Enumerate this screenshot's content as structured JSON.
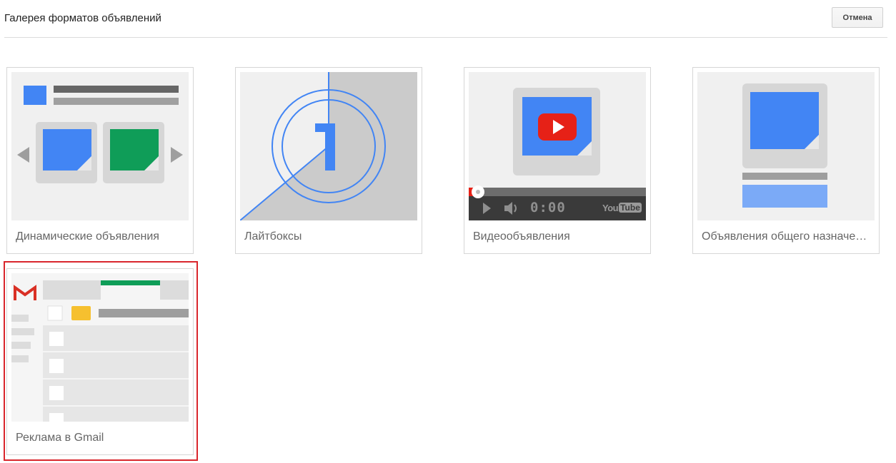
{
  "header": {
    "title": "Галерея форматов объявлений",
    "cancel_label": "Отмена"
  },
  "gallery": {
    "items": [
      {
        "label": "Динамические объявления",
        "icon": "dynamic-ads-illustration"
      },
      {
        "label": "Лайтбоксы",
        "icon": "lightbox-countdown-illustration"
      },
      {
        "label": "Видеообъявления",
        "icon": "video-player-illustration",
        "player_time": "0:00",
        "player_brand": "YouTube"
      },
      {
        "label": "Объявления общего назначения",
        "icon": "general-ad-illustration"
      },
      {
        "label": "Реклама в Gmail",
        "icon": "gmail-inbox-illustration",
        "selected": true
      }
    ]
  },
  "colors": {
    "accent_blue": "#4285f4",
    "accent_green": "#0f9d58",
    "selection_red": "#d9262c",
    "youtube_red": "#e62117",
    "gmail_yellow": "#f6c02f"
  }
}
